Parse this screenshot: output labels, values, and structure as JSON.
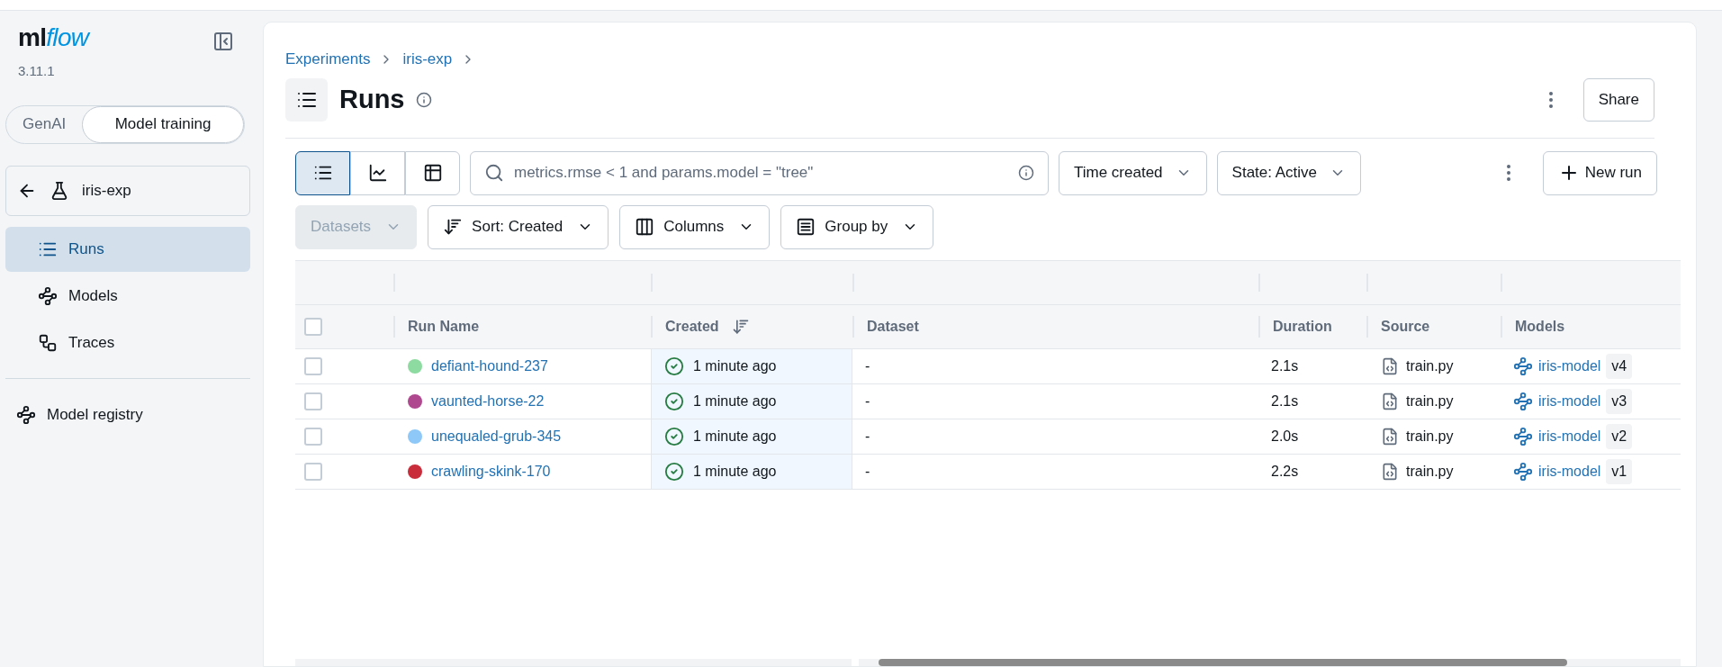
{
  "logo": {
    "main": "ml",
    "accent": "flow"
  },
  "version": "3.11.1",
  "mode_toggle": [
    {
      "label": "GenAI",
      "selected": false
    },
    {
      "label": "Model training",
      "selected": true
    }
  ],
  "experiment": {
    "name": "iris-exp"
  },
  "sidebar": {
    "items": [
      {
        "label": "Runs",
        "selected": true
      },
      {
        "label": "Models",
        "selected": false
      },
      {
        "label": "Traces",
        "selected": false
      }
    ],
    "registry": {
      "label": "Model registry"
    }
  },
  "breadcrumb": [
    "Experiments",
    "iris-exp"
  ],
  "title": "Runs",
  "header_actions": {
    "share": "Share"
  },
  "view_modes": [
    {
      "selected": true
    },
    {
      "selected": false
    },
    {
      "selected": false
    }
  ],
  "search": {
    "placeholder": "metrics.rmse < 1 and params.model = \"tree\""
  },
  "filters": [
    {
      "label": "Time created"
    },
    {
      "label": "State: Active"
    }
  ],
  "new_run": "New run",
  "toolbar2": [
    {
      "label": "Datasets",
      "disabled": true
    },
    {
      "label": "Sort: Created",
      "disabled": false
    },
    {
      "label": "Columns",
      "disabled": false
    },
    {
      "label": "Group by",
      "disabled": false
    }
  ],
  "table": {
    "header_checked": false,
    "columns": [
      "Run Name",
      "Created",
      "Dataset",
      "Duration",
      "Source",
      "Models"
    ],
    "rows": [
      {
        "checked": false,
        "color": "#8ddba0",
        "name": "defiant-hound-237",
        "created": "1 minute ago",
        "dataset": "-",
        "duration": "2.1s",
        "source": "train.py",
        "model": "iris-model",
        "version": "v4"
      },
      {
        "checked": false,
        "color": "#b0488f",
        "name": "vaunted-horse-22",
        "created": "1 minute ago",
        "dataset": "-",
        "duration": "2.1s",
        "source": "train.py",
        "model": "iris-model",
        "version": "v3"
      },
      {
        "checked": false,
        "color": "#8ec8f8",
        "name": "unequaled-grub-345",
        "created": "1 minute ago",
        "dataset": "-",
        "duration": "2.0s",
        "source": "train.py",
        "model": "iris-model",
        "version": "v2"
      },
      {
        "checked": false,
        "color": "#c92d3b",
        "name": "crawling-skink-170",
        "created": "1 minute ago",
        "dataset": "-",
        "duration": "2.2s",
        "source": "train.py",
        "model": "iris-model",
        "version": "v1"
      }
    ]
  }
}
